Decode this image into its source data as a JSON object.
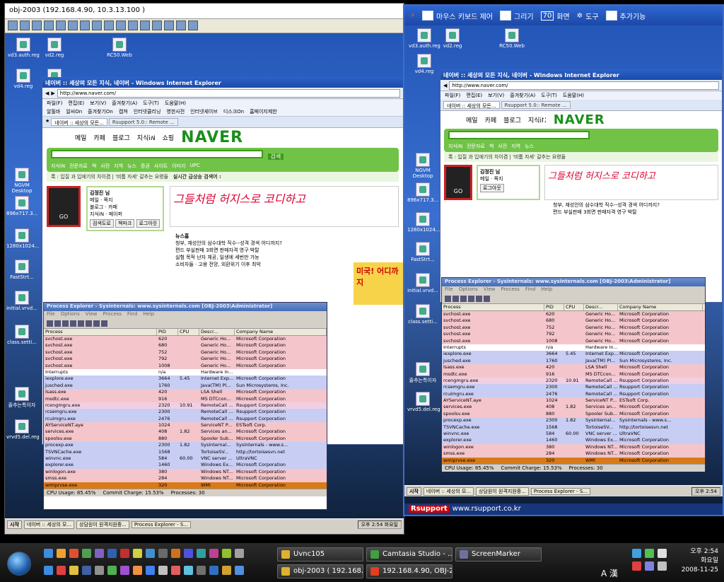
{
  "left_window": {
    "title": "obj-2003 (192.168.4.90, 10.3.13.100 )",
    "desktop_icons": [
      "vd3.auth.reg",
      "vd2.reg",
      "RC50.Web",
      "vd4.reg",
      "",
      "NGVM Desktop",
      "896x717.3...",
      "1280x1024...",
      "FastStrt...",
      "initial.vrvd...",
      "class.setti...",
      "줄추는특이자",
      "vrvd5.del.reg"
    ],
    "ie": {
      "title": "네이버 :: 세상의 모든 지식, 네이버 - Windows Internet Explorer",
      "url": "http://www.naver.com/",
      "menu": [
        "파일(F)",
        "편집(E)",
        "보기(V)",
        "즐겨찾기(A)",
        "도구(T)",
        "도움말(H)"
      ],
      "favs": [
        "알툴바",
        "알씨On",
        "즐겨찾기On",
        "캡쳐",
        "인터넷클리닝",
        "영한사전",
        "인터넷세이브",
        "디스크On",
        "홈페이지제한"
      ],
      "tabs": [
        "네이버 :: 세상의 모든...",
        "Rsupport 5.0:: Remote ..."
      ]
    },
    "taskbar": {
      "start": "시작",
      "buttons": [
        "네이버 :: 세상의 모...",
        "상담원이 원격지원중...",
        "Process Explorer - S..."
      ],
      "clock": "오후 2:54",
      "day": "화요일"
    }
  },
  "naver": {
    "top_links": [
      "메일",
      "카페",
      "블로그",
      "지식iN",
      "쇼핑"
    ],
    "logo": "NAVER",
    "ad_text": "그들처럼 허지스로 코디하고",
    "cats": [
      "지식iN",
      "전문자료",
      "책",
      "사전",
      "지역",
      "뉴스",
      "증권",
      "사이트",
      "이미지",
      "UPC"
    ],
    "strip": "록 : 입질 과 입에기의 차이겸 | '비툼 자세' 갈추는 요령들",
    "realtime": "실시간 급상승 검색어 :",
    "search_btn": "검색",
    "login_user": "김정진 님",
    "login_items": [
      "메일",
      "쪽지",
      "블로그",
      "카페",
      "지식iN",
      "페이퍼"
    ],
    "login_btns": [
      "검색도로",
      "책마크",
      "로그아웃"
    ],
    "news_title": "뉴스홈",
    "news_items": [
      "청부, 재성안의 삼수대학 직수--성격 경색 어디까지?",
      "편드 부실판매 3회면 판매자격 영구 박탈",
      "실험 목적 난자 체공, 일생에 세번만 가능",
      "소비자들 · 고용 전망, 외환위기 이후 최악"
    ],
    "ad2": "미국! 어디까지"
  },
  "process_explorer": {
    "title": "Process Explorer - Sysinternals: www.sysinternals.com [OBJ-2003\\Administrator]",
    "menu": [
      "File",
      "Options",
      "View",
      "Process",
      "Find",
      "Help"
    ],
    "columns": [
      "Process",
      "PID",
      "CPU",
      "Descr...",
      "Company Name"
    ],
    "rows": [
      {
        "name": "svchost.exe",
        "pid": "620",
        "cpu": "",
        "desc": "Generic Ho...",
        "company": "Microsoft Corporation",
        "cls": "c-svc"
      },
      {
        "name": "svchost.exe",
        "pid": "680",
        "cpu": "",
        "desc": "Generic Ho...",
        "company": "Microsoft Corporation",
        "cls": "c-svc"
      },
      {
        "name": "svchost.exe",
        "pid": "752",
        "cpu": "",
        "desc": "Generic Ho...",
        "company": "Microsoft Corporation",
        "cls": "c-svc"
      },
      {
        "name": "svchost.exe",
        "pid": "792",
        "cpu": "",
        "desc": "Generic Ho...",
        "company": "Microsoft Corporation",
        "cls": "c-svc"
      },
      {
        "name": "svchost.exe",
        "pid": "1008",
        "cpu": "",
        "desc": "Generic Ho...",
        "company": "Microsoft Corporation",
        "cls": "c-svc"
      },
      {
        "name": "Interrupts",
        "pid": "n/a",
        "cpu": "",
        "desc": "Hardware In...",
        "company": "",
        "cls": "c-plain"
      },
      {
        "name": "iexplore.exe",
        "pid": "3664",
        "cpu": "5.45",
        "desc": "Internet Exp...",
        "company": "Microsoft Corporation",
        "cls": "c-own"
      },
      {
        "name": "jusched.exe",
        "pid": "1760",
        "cpu": "",
        "desc": "Java(TM) Pl...",
        "company": "Sun Microsystems, Inc.",
        "cls": "c-own"
      },
      {
        "name": "lsass.exe",
        "pid": "420",
        "cpu": "",
        "desc": "LSA Shell",
        "company": "Microsoft Corporation",
        "cls": "c-svc"
      },
      {
        "name": "msdtc.exe",
        "pid": "916",
        "cpu": "",
        "desc": "MS DTCcon...",
        "company": "Microsoft Corporation",
        "cls": "c-svc"
      },
      {
        "name": "rcengmgru.exe",
        "pid": "2320",
        "cpu": "10.91",
        "desc": "RemoteCall ...",
        "company": "Rsupport Corporation",
        "cls": "c-jb"
      },
      {
        "name": "rcsemgru.exe",
        "pid": "2300",
        "cpu": "",
        "desc": "RemoteCall ...",
        "company": "Rsupport Corporation",
        "cls": "c-own"
      },
      {
        "name": "rcuimgru.exe",
        "pid": "2476",
        "cpu": "",
        "desc": "RemoteCall ...",
        "company": "Rsupport Corporation",
        "cls": "c-own"
      },
      {
        "name": "AYServiceNT.aye",
        "pid": "1024",
        "cpu": "",
        "desc": "ServiceNT P...",
        "company": "ESTsoft Corp.",
        "cls": "c-svc"
      },
      {
        "name": "services.exe",
        "pid": "408",
        "cpu": "1.82",
        "desc": "Services an...",
        "company": "Microsoft Corporation",
        "cls": "c-svc"
      },
      {
        "name": "spoolsv.exe",
        "pid": "880",
        "cpu": "",
        "desc": "Spooler Sub...",
        "company": "Microsoft Corporation",
        "cls": "c-svc"
      },
      {
        "name": "procexp.exe",
        "pid": "2300",
        "cpu": "1.82",
        "desc": "Sysinternal...",
        "company": "Sysinternals - www.s...",
        "cls": "c-own"
      },
      {
        "name": "TSVNCache.exe",
        "pid": "1568",
        "cpu": "",
        "desc": "TortoiseSV...",
        "company": "http://tortoisesvn.net",
        "cls": "c-own"
      },
      {
        "name": "winvnc.exe",
        "pid": "584",
        "cpu": "60.00",
        "desc": "VNC server ...",
        "company": "UltraVNC",
        "cls": "c-own"
      },
      {
        "name": "explorer.exe",
        "pid": "1460",
        "cpu": "",
        "desc": "Windows Ex...",
        "company": "Microsoft Corporation",
        "cls": "c-own"
      },
      {
        "name": "winlogon.exe",
        "pid": "380",
        "cpu": "",
        "desc": "Windows NT...",
        "company": "Microsoft Corporation",
        "cls": "c-svc"
      },
      {
        "name": "smss.exe",
        "pid": "284",
        "cpu": "",
        "desc": "Windows NT...",
        "company": "Microsoft Corporation",
        "cls": "c-svc"
      },
      {
        "name": "wmiprvse.exe",
        "pid": "320",
        "cpu": "",
        "desc": "WMI",
        "company": "Microsoft Corporation",
        "cls": "c-sel"
      }
    ],
    "status": {
      "cpu": "CPU Usage: 85.45%",
      "commit": "Commit Charge: 15.53%",
      "procs": "Processes: 30"
    }
  },
  "right_window": {
    "toolbar": [
      "마우스 키보드 제어",
      "그리기",
      "화면",
      "도구",
      "추가기능"
    ],
    "zoom": "70",
    "taskbar": {
      "start": "시작",
      "buttons": [
        "네이버 :: 세상의 모...",
        "상담원이 원격지원중...",
        "Process Explorer - S..."
      ],
      "clock": "오후 2:54"
    },
    "footer_brand": "Rsupport",
    "footer_url": "www.rsupport.co.kr",
    "desktop_icons": [
      "vd3.auth.reg",
      "vd2.reg",
      "RC50.Web",
      "vd4.reg",
      "",
      "NGVM Desktop",
      "896x717.3...",
      "1280x1024...",
      "FastStrt...",
      "initial.vrvd...",
      "class.setti...",
      "줄추는특이자",
      "vrvd5.del.reg"
    ]
  },
  "host_taskbar": {
    "buttons": [
      "Uvnc105",
      "Camtasia Studio - ...",
      "ScreenMarker",
      "obj-2003 ( 192.168.4...",
      "192.168.4.90, OBJ-20..."
    ],
    "ime": "A 漢",
    "clock": {
      "time": "오후 2:54",
      "day": "화요일",
      "date": "2008-11-25"
    }
  },
  "colors": {
    "host_bg": "#000000",
    "remote_desktop": "#2457b8",
    "naver_green": "#71c348",
    "pe_service": "#f4c6cc",
    "pe_own": "#c8cdf4",
    "pe_selected": "#d97a18"
  }
}
